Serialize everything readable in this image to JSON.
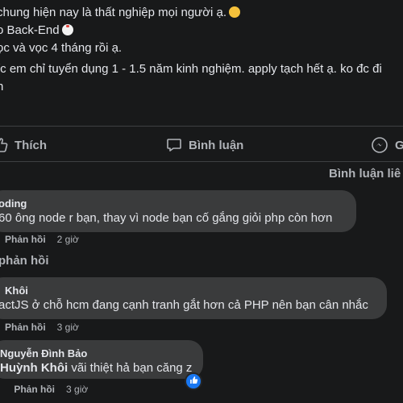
{
  "post": {
    "lines": [
      "chung hiện nay là thất nghiệp mọi người ạ.",
      "o Back-End",
      "ọc và vọc 4 tháng rồi ạ.",
      "/c em chỉ tuyển dụng 1 - 1.5 năm kinh nghiệm. apply tạch hết ạ. ko đc đi",
      "n"
    ],
    "emojis": [
      "grimacing-face-emoji",
      "chicken-emoji"
    ]
  },
  "actions": {
    "like": "Thích",
    "comment": "Bình luận",
    "share": "G"
  },
  "sort_label": "Bình luận liê",
  "comments": [
    {
      "author": "oding",
      "text": "60 ông node r bạn, thay vì node bạn cố gắng giỏi php còn hơn",
      "reply": "Phản hồi",
      "time": "2 giờ"
    },
    {
      "author": "Khôi",
      "text": "actJS ở chỗ hcm đang cạnh tranh gắt hơn cả PHP nên bạn cân nhắc",
      "reply": "Phản hồi",
      "time": "3 giờ"
    },
    {
      "author": "Nguyễn Đình Bảo",
      "mention": "Huỳnh Khôi",
      "text": " vãi thiệt hả bạn căng z",
      "reply": "Phản hồi",
      "time": "3 giờ"
    }
  ],
  "view_replies": "phản hồi",
  "colors": {
    "background": "#18191a",
    "bubble": "#3a3b3c",
    "text": "#e4e6eb",
    "muted": "#b0b3b8",
    "accent": "#1877f2"
  }
}
